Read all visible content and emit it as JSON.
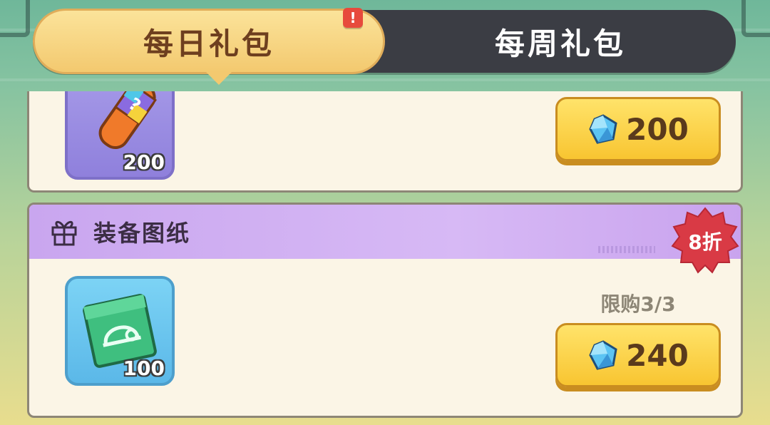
{
  "tabs": {
    "daily_label": "每日礼包",
    "weekly_label": "每周礼包",
    "alert_mark": "!"
  },
  "offers": [
    {
      "item_icon": "mystery-potion-icon",
      "quantity": "200",
      "price": "200",
      "currency_icon": "blue-gem-icon"
    },
    {
      "title": "装备图纸",
      "header_icon": "gift-icon",
      "item_icon": "blueprint-helmet-icon",
      "quantity": "100",
      "purchase_limit": "限购3/3",
      "price": "240",
      "currency_icon": "blue-gem-icon",
      "discount": "8折"
    }
  ],
  "colors": {
    "tab_active": "#f3c96f",
    "tab_inactive": "#3b3d44",
    "header_purple": "#c9a6ef",
    "button_yellow": "#f8c531",
    "discount_red": "#d93a45"
  }
}
